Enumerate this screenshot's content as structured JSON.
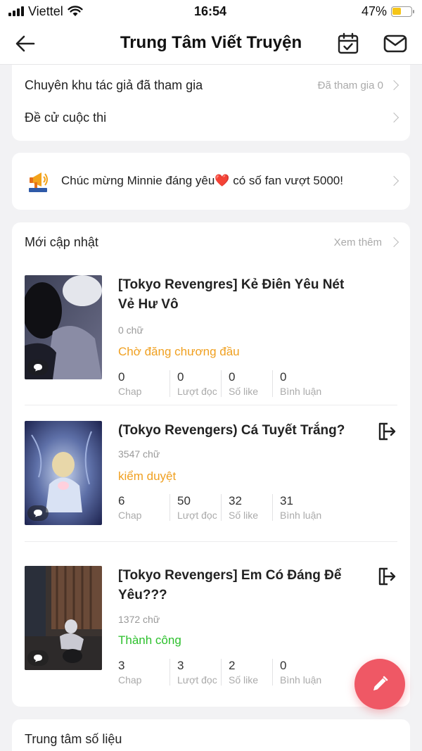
{
  "status_bar": {
    "carrier": "Viettel",
    "time": "16:54",
    "battery": "47%",
    "battery_level": 0.47
  },
  "nav": {
    "title": "Trung Tâm Viết Truyện"
  },
  "menu": [
    {
      "label": "Chuyên khu tác giả đã tham gia",
      "value": "Đã tham gia 0"
    },
    {
      "label": "Đề cử cuộc thi",
      "value": ""
    }
  ],
  "notice": {
    "text": "Chúc mừng Minnie đáng yêu❤️ có số fan vượt 5000!"
  },
  "recent": {
    "title": "Mới cập nhật",
    "more": "Xem thêm",
    "stories": [
      {
        "title": "[Tokyo Revengres] Kẻ Điên Yêu Nét Vẻ Hư Vô",
        "words": "0 chữ",
        "status": "Chờ đăng chương đầu",
        "status_color": "#f0a020",
        "stats": [
          {
            "value": "0",
            "label": "Chap"
          },
          {
            "value": "0",
            "label": "Lượt đọc"
          },
          {
            "value": "0",
            "label": "Số like"
          },
          {
            "value": "0",
            "label": "Bình luận"
          }
        ]
      },
      {
        "title": "(Tokyo Revengers) Cá Tuyết Trắng?",
        "words": "3547 chữ",
        "status": "kiểm duyệt",
        "status_color": "#f0a020",
        "stats": [
          {
            "value": "6",
            "label": "Chap"
          },
          {
            "value": "50",
            "label": "Lượt đọc"
          },
          {
            "value": "32",
            "label": "Số like"
          },
          {
            "value": "31",
            "label": "Bình luận"
          }
        ]
      },
      {
        "title": "[Tokyo Revengers] Em Có Đáng Để Yêu???",
        "words": "1372 chữ",
        "status": "Thành công",
        "status_color": "#2cc02c",
        "stats": [
          {
            "value": "3",
            "label": "Chap"
          },
          {
            "value": "3",
            "label": "Lượt đọc"
          },
          {
            "value": "2",
            "label": "Số like"
          },
          {
            "value": "0",
            "label": "Bình luận"
          }
        ]
      }
    ]
  },
  "data_center": {
    "title": "Trung tâm số liệu"
  },
  "icons": {
    "back": "arrow-left-icon",
    "calendar": "calendar-check-icon",
    "mail": "mail-icon",
    "megaphone": "megaphone-icon",
    "comment": "comment-bubble-icon",
    "withdraw": "withdraw-icon",
    "edit": "pencil-icon"
  },
  "colors": {
    "accent": "#ef5865",
    "warning": "#f0a020",
    "success": "#2cc02c"
  }
}
